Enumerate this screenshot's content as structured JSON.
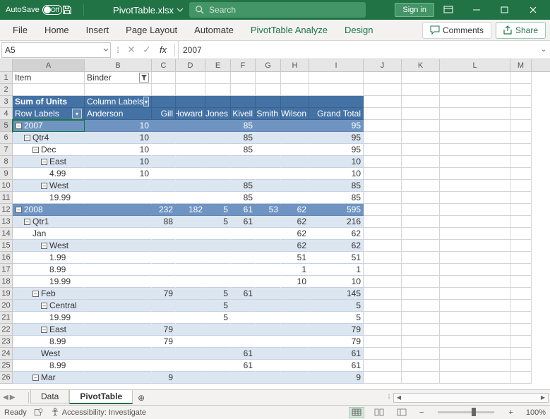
{
  "title_bar": {
    "autosave_label": "AutoSave",
    "autosave_state": "Off",
    "filename": "PivotTable.xlsx",
    "search_placeholder": "Search",
    "signin": "Sign in"
  },
  "ribbon": {
    "tabs": [
      "File",
      "Home",
      "Insert",
      "Page Layout",
      "Automate"
    ],
    "context_tabs": [
      "PivotTable Analyze",
      "Design"
    ],
    "comments": "Comments",
    "share": "Share"
  },
  "formula_bar": {
    "name_box": "A5",
    "formula": "2007",
    "fx": "fx"
  },
  "columns": [
    "A",
    "B",
    "C",
    "D",
    "E",
    "F",
    "G",
    "H",
    "I",
    "J",
    "K",
    "L",
    "M"
  ],
  "pivot": {
    "report_filter_field": "Item",
    "report_filter_value": "Binder",
    "values_label": "Sum of Units",
    "column_labels": "Column Labels",
    "row_labels": "Row Labels",
    "cols": [
      "Anderson",
      "Gill",
      "Howard",
      "Jones",
      "Kivell",
      "Smith",
      "Wilson",
      "Grand Total"
    ]
  },
  "rows": [
    {
      "n": 5,
      "type": "year",
      "label": "2007",
      "indent": 0,
      "exp": "–",
      "B": "10",
      "F": "85",
      "I": "95"
    },
    {
      "n": 6,
      "type": "band",
      "label": "Qtr4",
      "indent": 1,
      "exp": "–",
      "B": "10",
      "F": "85",
      "I": "95"
    },
    {
      "n": 7,
      "type": "light",
      "label": "Dec",
      "indent": 2,
      "exp": "–",
      "B": "10",
      "F": "85",
      "I": "95"
    },
    {
      "n": 8,
      "type": "band",
      "label": "East",
      "indent": 3,
      "exp": "–",
      "B": "10",
      "I": "10"
    },
    {
      "n": 9,
      "type": "light",
      "label": "4.99",
      "indent": 4,
      "B": "10",
      "I": "10"
    },
    {
      "n": 10,
      "type": "band",
      "label": "West",
      "indent": 3,
      "exp": "–",
      "F": "85",
      "I": "85"
    },
    {
      "n": 11,
      "type": "light",
      "label": "19.99",
      "indent": 4,
      "F": "85",
      "I": "85"
    },
    {
      "n": 12,
      "type": "year",
      "label": "2008",
      "indent": 0,
      "exp": "–",
      "C": "232",
      "D": "182",
      "E": "5",
      "F": "61",
      "G": "53",
      "H": "62",
      "I": "595"
    },
    {
      "n": 13,
      "type": "band",
      "label": "Qtr1",
      "indent": 1,
      "exp": "–",
      "C": "88",
      "E": "5",
      "F": "61",
      "H": "62",
      "I": "216"
    },
    {
      "n": 14,
      "type": "light",
      "label": "Jan",
      "indent": 2,
      "H": "62",
      "I": "62"
    },
    {
      "n": 15,
      "type": "band",
      "label": "West",
      "indent": 3,
      "exp": "–",
      "H": "62",
      "I": "62"
    },
    {
      "n": 16,
      "type": "light",
      "label": "1.99",
      "indent": 4,
      "H": "51",
      "I": "51"
    },
    {
      "n": 17,
      "type": "light",
      "label": "8.99",
      "indent": 4,
      "H": "1",
      "I": "1"
    },
    {
      "n": 18,
      "type": "light",
      "label": "19.99",
      "indent": 4,
      "H": "10",
      "I": "10"
    },
    {
      "n": 19,
      "type": "band",
      "label": "Feb",
      "indent": 2,
      "exp": "–",
      "C": "79",
      "E": "5",
      "F": "61",
      "I": "145"
    },
    {
      "n": 20,
      "type": "band",
      "label": "Central",
      "indent": 3,
      "exp": "–",
      "E": "5",
      "I": "5"
    },
    {
      "n": 21,
      "type": "light",
      "label": "19.99",
      "indent": 4,
      "E": "5",
      "I": "5"
    },
    {
      "n": 22,
      "type": "band",
      "label": "East",
      "indent": 3,
      "exp": "–",
      "C": "79",
      "I": "79"
    },
    {
      "n": 23,
      "type": "light",
      "label": "8.99",
      "indent": 4,
      "C": "79",
      "I": "79"
    },
    {
      "n": 24,
      "type": "band",
      "label": "West",
      "indent": 3,
      "F": "61",
      "I": "61"
    },
    {
      "n": 25,
      "type": "light",
      "label": "8.99",
      "indent": 4,
      "F": "61",
      "I": "61"
    },
    {
      "n": 26,
      "type": "band",
      "label": "Mar",
      "indent": 2,
      "exp": "–",
      "C": "9",
      "I": "9"
    }
  ],
  "sheet_tabs": {
    "sheets": [
      "Data",
      "PivotTable"
    ],
    "active": 1
  },
  "status": {
    "ready": "Ready",
    "accessibility": "Accessibility: Investigate",
    "zoom": "100%"
  }
}
